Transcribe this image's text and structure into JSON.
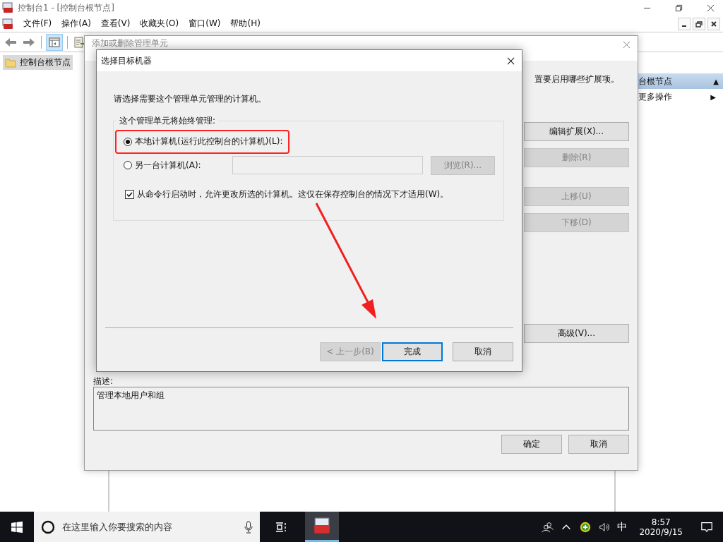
{
  "main_window": {
    "title": "控制台1 - [控制台根节点]",
    "menu": [
      "文件(F)",
      "操作(A)",
      "查看(V)",
      "收藏夹(O)",
      "窗口(W)",
      "帮助(H)"
    ],
    "tree": [
      {
        "label": "控制台根节点",
        "selected": true
      }
    ],
    "actions_pane": {
      "header": "台根节点",
      "header_icon": "▲",
      "items": [
        {
          "label": "更多操作",
          "arrow": "▶"
        }
      ]
    }
  },
  "snapin_dialog": {
    "title": "添加或删除管理单元",
    "instruction": "置要启用哪些扩展项。",
    "buttons": [
      {
        "label": "编辑扩展(X)...",
        "disabled": false
      },
      {
        "label": "删除(R)",
        "disabled": true
      },
      {
        "label": "上移(U)",
        "disabled": true
      },
      {
        "label": "下移(D)",
        "disabled": true
      },
      {
        "label": "高级(V)...",
        "disabled": false
      }
    ],
    "description_label": "描述:",
    "description": "管理本地用户和组",
    "footer_buttons": [
      "确定",
      "取消"
    ]
  },
  "target_dialog": {
    "title": "选择目标机器",
    "prompt": "请选择需要这个管理单元管理的计算机。",
    "group_label": "这个管理单元将始终管理:",
    "options": [
      {
        "label": "本地计算机(运行此控制台的计算机)(L):",
        "selected": true,
        "highlighted": true
      },
      {
        "label": "另一台计算机(A):",
        "selected": false,
        "highlighted": false
      }
    ],
    "computer_field": {
      "disabled": true
    },
    "browse_button": {
      "label": "浏览(R)...",
      "disabled": true
    },
    "allow_change": {
      "label": "从命令行启动时，允许更改所选的计算机。这仅在保存控制台的情况下才适用(W)。",
      "checked": true
    },
    "buttons": [
      {
        "label": "< 上一步(B)",
        "disabled": true,
        "default": false
      },
      {
        "label": "完成",
        "disabled": false,
        "default": true
      },
      {
        "label": "取消",
        "disabled": false,
        "default": false
      }
    ]
  },
  "taskbar": {
    "search_placeholder": "在这里输入你要搜索的内容",
    "ime": "中",
    "time": "8:57",
    "date": "2020/9/15"
  }
}
